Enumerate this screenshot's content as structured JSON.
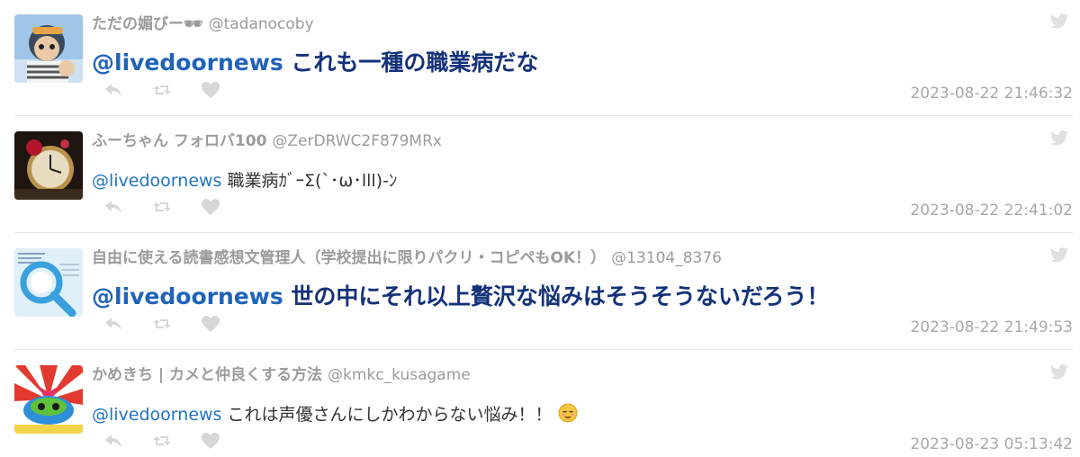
{
  "tweets": [
    {
      "name": "ただの媚びー🕶",
      "handle": "@tadanocoby",
      "mention": "@livedoornews",
      "body": " これも一種の職業病だな",
      "time": "2023-08-22 21:46:32"
    },
    {
      "name": "ふーちゃん フォロバ100",
      "handle": "@ZerDRWC2F879MRx",
      "mention": "@livedoornews",
      "body": " 職業病ｶﾞｰΣ(`･ω･lll)-ﾝ",
      "time": "2023-08-22 22:41:02"
    },
    {
      "name": "自由に使える読書感想文管理人（学校提出に限りパクリ・コピペもOK！）",
      "handle": "@13104_8376",
      "mention": "@livedoornews",
      "body": " 世の中にそれ以上贅沢な悩みはそうそうないだろう！",
      "time": "2023-08-22 21:49:53"
    },
    {
      "name": "かめきち | カメと仲良くする方法",
      "handle": "@kmkc_kusagame",
      "mention": "@livedoornews",
      "body": " これは声優さんにしかわからない悩み！！",
      "time": "2023-08-23 05:13:42"
    }
  ],
  "icons": {
    "reply": "reply-icon",
    "retweet": "retweet-icon",
    "like": "heart-icon",
    "platform": "twitter-bird-icon",
    "emoji": "relieved-face-emoji"
  },
  "colors": {
    "mention": "#1f74c4",
    "big_text": "#14327a",
    "meta": "#9b9b9b",
    "icon": "#d7d7d7"
  }
}
